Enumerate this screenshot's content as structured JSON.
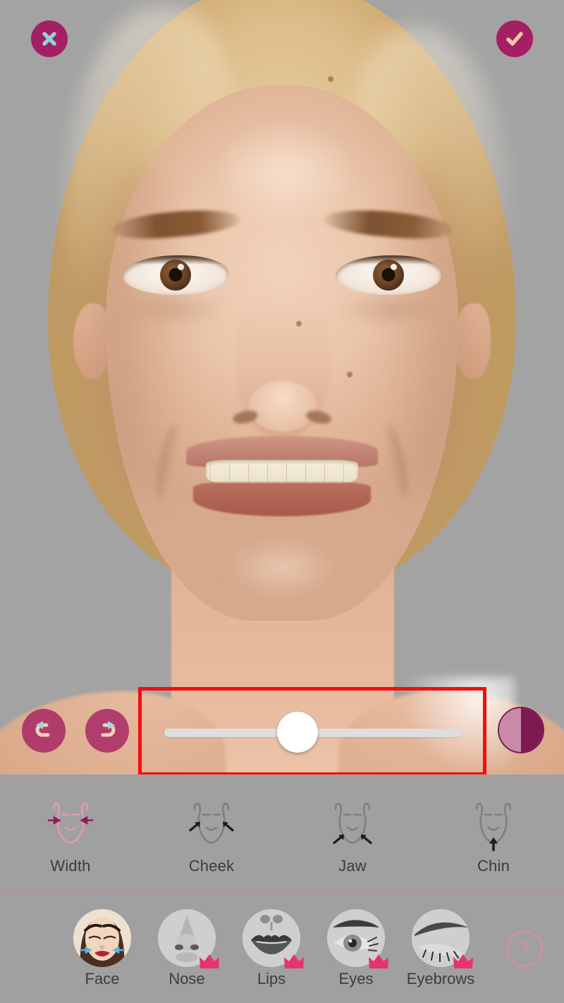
{
  "app": {
    "title": "Face Reshape Editor",
    "background_color": "#a0a0a0"
  },
  "colors": {
    "accent_magenta": "#a41f63",
    "accent_dark_magenta": "#7d1850",
    "accent_pink": "#cf8fa8",
    "crown_pink": "#e8336e",
    "annotation_red": "#f60d0d",
    "label_text": "#3c3c3c",
    "track": "#dedede",
    "thumb": "#ffffff"
  },
  "topbar": {
    "close": {
      "label": "Cancel",
      "icon": "close-x-icon",
      "glyph": "✕"
    },
    "done": {
      "label": "Apply",
      "icon": "check-icon",
      "glyph": "✓"
    }
  },
  "slider_row": {
    "undo": {
      "label": "Undo",
      "icon": "undo-arrow-icon"
    },
    "redo": {
      "label": "Redo",
      "icon": "redo-arrow-icon"
    },
    "compare": {
      "label": "Compare before/after",
      "icon": "half-circle-contrast-icon"
    },
    "slider": {
      "name": "intensity-slider",
      "value": 50,
      "min": 0,
      "max": 100,
      "thumb_position_percent": 45
    },
    "annotation": {
      "name": "red-highlight-box",
      "color": "#f60d0d"
    }
  },
  "sub_toolbar": {
    "selected": "Width",
    "items": [
      {
        "label": "Width",
        "icon": "face-width-arrows-icon",
        "active": true
      },
      {
        "label": "Cheek",
        "icon": "face-cheek-arrows-icon",
        "active": false
      },
      {
        "label": "Jaw",
        "icon": "face-jaw-arrows-icon",
        "active": false
      },
      {
        "label": "Chin",
        "icon": "face-chin-arrow-icon",
        "active": false
      }
    ]
  },
  "bottom_nav": {
    "selected": "Face",
    "items": [
      {
        "label": "Face",
        "icon": "face-thumbnail-icon",
        "premium": false,
        "active": true
      },
      {
        "label": "Nose",
        "icon": "nose-thumbnail-icon",
        "premium": true,
        "active": false
      },
      {
        "label": "Lips",
        "icon": "lips-thumbnail-icon",
        "premium": true,
        "active": false
      },
      {
        "label": "Eyes",
        "icon": "eye-thumbnail-icon",
        "premium": true,
        "active": false
      },
      {
        "label": "Eyebrows",
        "icon": "eyebrow-thumbnail-icon",
        "premium": true,
        "active": false
      }
    ],
    "help": {
      "label": "?",
      "icon": "help-question-icon"
    }
  }
}
